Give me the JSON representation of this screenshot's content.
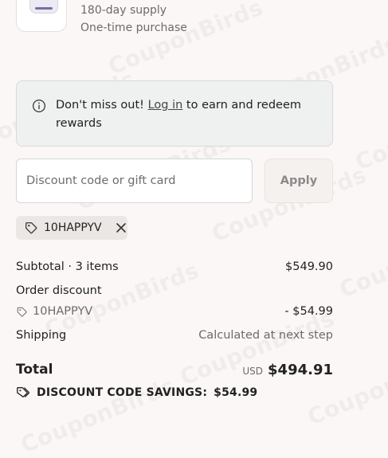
{
  "product": {
    "supply": "180-day supply",
    "purchase_type": "One-time purchase"
  },
  "notice": {
    "prefix": "Don't miss out!",
    "link": "Log in",
    "suffix": "to earn and redeem rewards"
  },
  "discount": {
    "placeholder": "Discount code or gift card",
    "apply_label": "Apply",
    "applied_code": "10HAPPYV"
  },
  "summary": {
    "subtotal_label": "Subtotal · 3 items",
    "subtotal_value": "$549.90",
    "order_discount_label": "Order discount",
    "discount_code": "10HAPPYV",
    "discount_value": "- $54.99",
    "shipping_label": "Shipping",
    "shipping_value": "Calculated at next step",
    "total_label": "Total",
    "currency": "USD",
    "total_value": "$494.91",
    "savings_label": "DISCOUNT CODE SAVINGS:",
    "savings_value": "$54.99"
  },
  "watermark": "CouponBirds",
  "colors": {
    "background": "#fbf7f6",
    "notice_bg": "#eff1f0",
    "chip_bg": "#ebe7e5"
  }
}
